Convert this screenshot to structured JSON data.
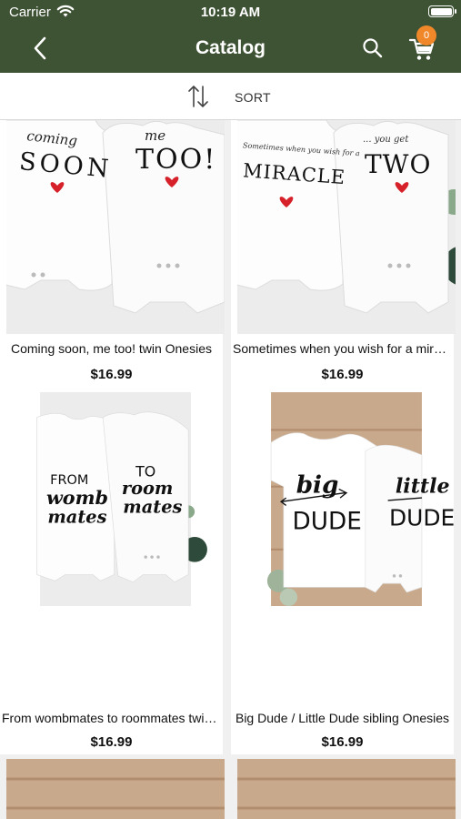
{
  "status_bar": {
    "carrier": "Carrier",
    "time": "10:19 AM"
  },
  "nav": {
    "title": "Catalog",
    "cart_count": "0",
    "icons": [
      "back-chevron-icon",
      "search-icon",
      "cart-icon"
    ]
  },
  "sort": {
    "label": "SORT",
    "icon": "sort-arrows-icon"
  },
  "colors": {
    "header": "#3e5234",
    "badge": "#f0882a",
    "background": "#f0f0f0"
  },
  "products": [
    {
      "name": "Coming soon, me too! twin Onesies",
      "price": "$16.99",
      "print_left": [
        "coming",
        "SOON"
      ],
      "print_right": [
        "me",
        "TOO!"
      ]
    },
    {
      "name": "Sometimes when you wish for a miracle",
      "price": "$16.99",
      "print_left": [
        "Sometimes when you wish for a",
        "MIRACLE"
      ],
      "print_right": [
        "... you get",
        "TWO"
      ]
    },
    {
      "name": "From wombmates to roommates twin Onesies",
      "price": "$16.99",
      "print_left": [
        "FROM",
        "womb",
        "mates"
      ],
      "print_right": [
        "TO",
        "room",
        "mates"
      ]
    },
    {
      "name": "Big Dude / Little Dude sibling Onesies",
      "price": "$16.99",
      "print_left": [
        "big",
        "DUDE"
      ],
      "print_right": [
        "little",
        "DUDE"
      ]
    }
  ]
}
